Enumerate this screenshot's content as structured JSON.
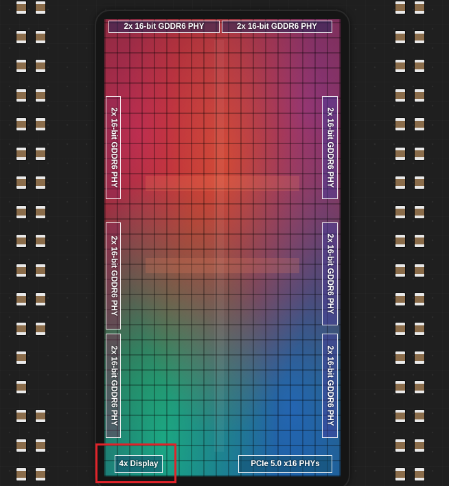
{
  "die_labels": {
    "top_left": "2x 16-bit GDDR6 PHY",
    "top_right": "2x 16-bit GDDR6 PHY",
    "left_1": "2x 16-bit GDDR6 PHY",
    "left_2": "2x 16-bit GDDR6 PHY",
    "left_3": "2x 16-bit GDDR6 PHY",
    "right_1": "2x 16-bit GDDR6 PHY",
    "right_2": "2x 16-bit GDDR6 PHY",
    "right_3": "2x 16-bit GDDR6 PHY",
    "bottom_left": "4x Display",
    "bottom_right": "PCIe 5.0 x16 PHYs"
  },
  "colors": {
    "highlight_box": "#e0232a",
    "background": "#1f1f1f",
    "label_text": "#ffffff"
  }
}
